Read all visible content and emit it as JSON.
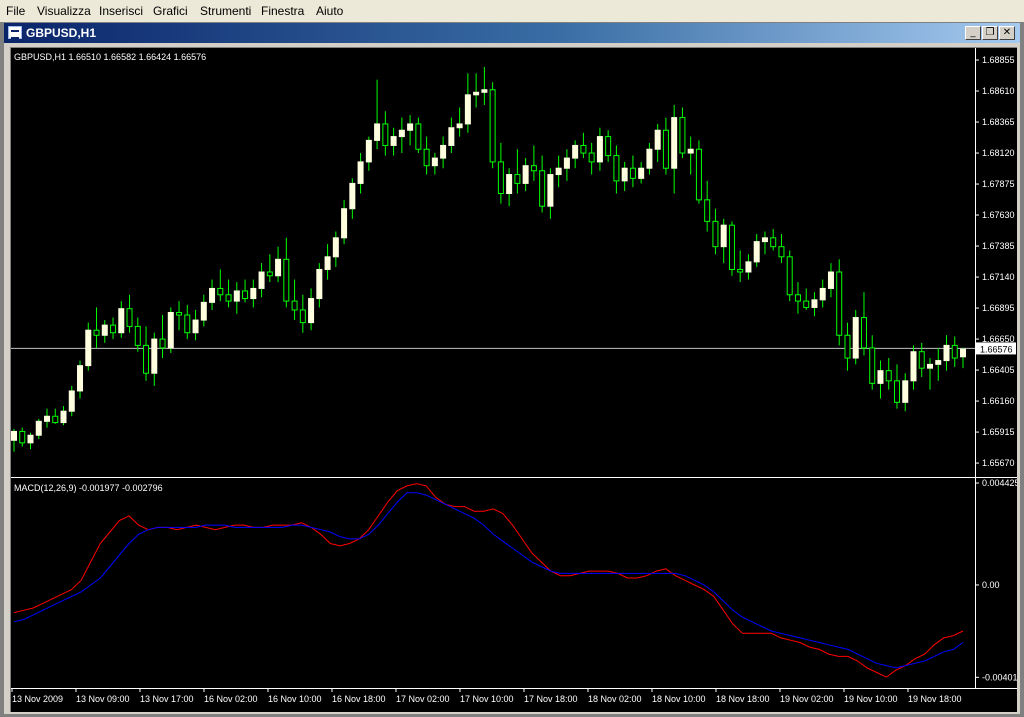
{
  "menu": [
    "File",
    "Visualizza",
    "Inserisci",
    "Grafici",
    "Strumenti",
    "Finestra",
    "Aiuto"
  ],
  "window": {
    "title": "GBPUSD,H1"
  },
  "colors": {
    "bull": "#ffffe0",
    "wick": "#00ff00",
    "price_line": "#c0c0c0",
    "macd": "#ff0000",
    "signal": "#0000ff",
    "axis_text": "#ffffff",
    "background": "#000000"
  },
  "chart_data": [
    {
      "type": "candlestick",
      "title": "GBPUSD,H1  1.66510 1.66582 1.66424 1.66576",
      "ylim": [
        1.6556,
        1.6895
      ],
      "y_ticks": [
        "1.68855",
        "1.68610",
        "1.68365",
        "1.68120",
        "1.67875",
        "1.67630",
        "1.67385",
        "1.67140",
        "1.66895",
        "1.66650",
        "1.66405",
        "1.66160",
        "1.65915",
        "1.65670"
      ],
      "current_price": "1.66576",
      "ohlc": [
        [
          1.6585,
          1.6594,
          1.6576,
          1.6592
        ],
        [
          1.6592,
          1.6595,
          1.658,
          1.6583
        ],
        [
          1.6583,
          1.6591,
          1.6578,
          1.6589
        ],
        [
          1.6589,
          1.6602,
          1.6586,
          1.66
        ],
        [
          1.66,
          1.661,
          1.6595,
          1.6604
        ],
        [
          1.6604,
          1.661,
          1.6598,
          1.6599
        ],
        [
          1.6599,
          1.6612,
          1.6597,
          1.6608
        ],
        [
          1.6608,
          1.6628,
          1.6604,
          1.6624
        ],
        [
          1.6624,
          1.6648,
          1.6618,
          1.6644
        ],
        [
          1.6644,
          1.6678,
          1.664,
          1.6672
        ],
        [
          1.6672,
          1.669,
          1.6658,
          1.6668
        ],
        [
          1.6668,
          1.668,
          1.6662,
          1.6676
        ],
        [
          1.6676,
          1.6682,
          1.6665,
          1.667
        ],
        [
          1.667,
          1.6695,
          1.6666,
          1.6689
        ],
        [
          1.6689,
          1.67,
          1.667,
          1.6675
        ],
        [
          1.6675,
          1.6682,
          1.6655,
          1.666
        ],
        [
          1.666,
          1.6675,
          1.6632,
          1.6638
        ],
        [
          1.6638,
          1.667,
          1.6628,
          1.6665
        ],
        [
          1.6665,
          1.6684,
          1.665,
          1.6658
        ],
        [
          1.6658,
          1.669,
          1.6654,
          1.6686
        ],
        [
          1.6686,
          1.6695,
          1.6672,
          1.6684
        ],
        [
          1.6684,
          1.6692,
          1.6665,
          1.667
        ],
        [
          1.667,
          1.6688,
          1.6664,
          1.668
        ],
        [
          1.668,
          1.67,
          1.6675,
          1.6694
        ],
        [
          1.6694,
          1.6712,
          1.6688,
          1.6705
        ],
        [
          1.6705,
          1.672,
          1.6695,
          1.67
        ],
        [
          1.67,
          1.6712,
          1.669,
          1.6695
        ],
        [
          1.6695,
          1.671,
          1.6685,
          1.6703
        ],
        [
          1.6703,
          1.6712,
          1.6694,
          1.6697
        ],
        [
          1.6697,
          1.6712,
          1.669,
          1.6705
        ],
        [
          1.6705,
          1.6725,
          1.6698,
          1.6718
        ],
        [
          1.6718,
          1.6732,
          1.671,
          1.6715
        ],
        [
          1.6715,
          1.6738,
          1.671,
          1.6728
        ],
        [
          1.6728,
          1.6745,
          1.669,
          1.6695
        ],
        [
          1.6695,
          1.6712,
          1.668,
          1.6688
        ],
        [
          1.6688,
          1.67,
          1.667,
          1.6678
        ],
        [
          1.6678,
          1.6705,
          1.6672,
          1.6697
        ],
        [
          1.6697,
          1.6725,
          1.669,
          1.672
        ],
        [
          1.672,
          1.674,
          1.6712,
          1.673
        ],
        [
          1.673,
          1.675,
          1.6722,
          1.6745
        ],
        [
          1.6745,
          1.6775,
          1.674,
          1.6768
        ],
        [
          1.6768,
          1.6792,
          1.676,
          1.6788
        ],
        [
          1.6788,
          1.6812,
          1.678,
          1.6805
        ],
        [
          1.6805,
          1.6825,
          1.6798,
          1.6822
        ],
        [
          1.6822,
          1.687,
          1.6815,
          1.6835
        ],
        [
          1.6835,
          1.6845,
          1.681,
          1.6818
        ],
        [
          1.6818,
          1.6832,
          1.681,
          1.6825
        ],
        [
          1.6825,
          1.684,
          1.6812,
          1.683
        ],
        [
          1.683,
          1.6842,
          1.6818,
          1.6835
        ],
        [
          1.6835,
          1.684,
          1.6812,
          1.6815
        ],
        [
          1.6815,
          1.6825,
          1.6795,
          1.6802
        ],
        [
          1.6802,
          1.6812,
          1.6795,
          1.6808
        ],
        [
          1.6808,
          1.6825,
          1.68,
          1.6818
        ],
        [
          1.6818,
          1.684,
          1.6812,
          1.6832
        ],
        [
          1.6832,
          1.6848,
          1.6825,
          1.6835
        ],
        [
          1.6835,
          1.6875,
          1.6828,
          1.6858
        ],
        [
          1.6858,
          1.6875,
          1.6848,
          1.686
        ],
        [
          1.686,
          1.688,
          1.685,
          1.6862
        ],
        [
          1.6862,
          1.6868,
          1.68,
          1.6805
        ],
        [
          1.6805,
          1.682,
          1.6772,
          1.678
        ],
        [
          1.678,
          1.68,
          1.677,
          1.6795
        ],
        [
          1.6795,
          1.6815,
          1.678,
          1.6788
        ],
        [
          1.6788,
          1.6808,
          1.6782,
          1.6802
        ],
        [
          1.6802,
          1.6818,
          1.679,
          1.6798
        ],
        [
          1.6798,
          1.681,
          1.6765,
          1.677
        ],
        [
          1.677,
          1.68,
          1.676,
          1.6795
        ],
        [
          1.6795,
          1.681,
          1.6785,
          1.68
        ],
        [
          1.68,
          1.6815,
          1.679,
          1.6808
        ],
        [
          1.6808,
          1.6822,
          1.68,
          1.6818
        ],
        [
          1.6818,
          1.6828,
          1.6808,
          1.6812
        ],
        [
          1.6812,
          1.682,
          1.6795,
          1.6805
        ],
        [
          1.6805,
          1.6832,
          1.6798,
          1.6825
        ],
        [
          1.6825,
          1.683,
          1.6805,
          1.681
        ],
        [
          1.681,
          1.6818,
          1.678,
          1.679
        ],
        [
          1.679,
          1.6805,
          1.6782,
          1.68
        ],
        [
          1.68,
          1.681,
          1.6785,
          1.6792
        ],
        [
          1.6792,
          1.6805,
          1.6788,
          1.68
        ],
        [
          1.68,
          1.682,
          1.6795,
          1.6815
        ],
        [
          1.6815,
          1.6835,
          1.6805,
          1.683
        ],
        [
          1.683,
          1.684,
          1.6795,
          1.68
        ],
        [
          1.68,
          1.685,
          1.678,
          1.684
        ],
        [
          1.684,
          1.6848,
          1.6808,
          1.6812
        ],
        [
          1.6812,
          1.6825,
          1.6795,
          1.6815
        ],
        [
          1.6815,
          1.6822,
          1.6772,
          1.6775
        ],
        [
          1.6775,
          1.679,
          1.675,
          1.6758
        ],
        [
          1.6758,
          1.6768,
          1.6732,
          1.6738
        ],
        [
          1.6738,
          1.676,
          1.6725,
          1.6755
        ],
        [
          1.6755,
          1.6758,
          1.6715,
          1.672
        ],
        [
          1.672,
          1.6735,
          1.671,
          1.6718
        ],
        [
          1.6718,
          1.6732,
          1.6712,
          1.6726
        ],
        [
          1.6726,
          1.6748,
          1.6722,
          1.6742
        ],
        [
          1.6742,
          1.675,
          1.6732,
          1.6745
        ],
        [
          1.6745,
          1.6752,
          1.6735,
          1.6738
        ],
        [
          1.6738,
          1.6748,
          1.6725,
          1.673
        ],
        [
          1.673,
          1.6735,
          1.6695,
          1.67
        ],
        [
          1.67,
          1.671,
          1.6685,
          1.6695
        ],
        [
          1.6695,
          1.6705,
          1.6688,
          1.669
        ],
        [
          1.669,
          1.6702,
          1.6683,
          1.6696
        ],
        [
          1.6696,
          1.6712,
          1.669,
          1.6705
        ],
        [
          1.6705,
          1.6725,
          1.6698,
          1.6718
        ],
        [
          1.6718,
          1.6728,
          1.666,
          1.6668
        ],
        [
          1.6668,
          1.6678,
          1.664,
          1.665
        ],
        [
          1.665,
          1.6688,
          1.6645,
          1.6682
        ],
        [
          1.6682,
          1.6702,
          1.6652,
          1.6658
        ],
        [
          1.6658,
          1.6668,
          1.6625,
          1.663
        ],
        [
          1.663,
          1.6648,
          1.6618,
          1.664
        ],
        [
          1.664,
          1.665,
          1.6625,
          1.6632
        ],
        [
          1.6632,
          1.6645,
          1.661,
          1.6615
        ],
        [
          1.6615,
          1.6638,
          1.6608,
          1.6632
        ],
        [
          1.6632,
          1.666,
          1.6625,
          1.6655
        ],
        [
          1.6655,
          1.6662,
          1.6635,
          1.6642
        ],
        [
          1.6642,
          1.665,
          1.6625,
          1.6645
        ],
        [
          1.6645,
          1.6658,
          1.6632,
          1.6648
        ],
        [
          1.6648,
          1.6668,
          1.664,
          1.666
        ],
        [
          1.666,
          1.6667,
          1.6643,
          1.665
        ],
        [
          1.6651,
          1.6658,
          1.6642,
          1.6657
        ]
      ]
    },
    {
      "type": "line",
      "title": "MACD(12,26,9) -0.001977 -0.002796",
      "ylim": [
        -0.0043,
        0.0046
      ],
      "y_ticks": [
        "0.004425",
        "0.00",
        "-0.00401"
      ],
      "series": [
        {
          "values": [
            -0.0012,
            -0.0011,
            -0.001,
            -0.0008,
            -0.0006,
            -0.0004,
            -0.0002,
            0.0002,
            0.001,
            0.0018,
            0.0023,
            0.0028,
            0.003,
            0.0026,
            0.0024,
            0.0025,
            0.0025,
            0.0024,
            0.0025,
            0.0026,
            0.0025,
            0.0024,
            0.0025,
            0.0026,
            0.0026,
            0.0025,
            0.0025,
            0.0026,
            0.0026,
            0.0026,
            0.0027,
            0.0025,
            0.0022,
            0.0018,
            0.0017,
            0.0018,
            0.002,
            0.0024,
            0.003,
            0.0036,
            0.0041,
            0.0043,
            0.0044,
            0.0043,
            0.0038,
            0.0035,
            0.0034,
            0.0034,
            0.0032,
            0.0032,
            0.0033,
            0.0031,
            0.0026,
            0.002,
            0.0014,
            0.001,
            0.0006,
            0.0004,
            0.0004,
            0.0005,
            0.0006,
            0.0006,
            0.0006,
            0.0005,
            0.0003,
            0.0003,
            0.0004,
            0.0006,
            0.0007,
            0.0004,
            0.0002,
            0.0,
            -0.0002,
            -0.0005,
            -0.0011,
            -0.0017,
            -0.0021,
            -0.0021,
            -0.0021,
            -0.0021,
            -0.0023,
            -0.0024,
            -0.0025,
            -0.0027,
            -0.0028,
            -0.003,
            -0.0031,
            -0.0031,
            -0.0033,
            -0.0036,
            -0.0038,
            -0.004,
            -0.0037,
            -0.0035,
            -0.0032,
            -0.003,
            -0.0026,
            -0.0023,
            -0.0022,
            -0.002
          ]
        },
        {
          "values": [
            -0.0016,
            -0.0015,
            -0.0013,
            -0.0011,
            -0.0009,
            -0.0007,
            -0.0005,
            -0.0003,
            0.0,
            0.0003,
            0.0008,
            0.0013,
            0.0018,
            0.0022,
            0.0024,
            0.0025,
            0.0025,
            0.0025,
            0.0025,
            0.0025,
            0.0026,
            0.0026,
            0.0026,
            0.0025,
            0.0025,
            0.0025,
            0.0025,
            0.0025,
            0.0025,
            0.0026,
            0.0026,
            0.0025,
            0.0024,
            0.0023,
            0.0021,
            0.002,
            0.002,
            0.0022,
            0.0026,
            0.0031,
            0.0036,
            0.004,
            0.004,
            0.0039,
            0.0037,
            0.0035,
            0.0033,
            0.0031,
            0.0029,
            0.0026,
            0.0022,
            0.0019,
            0.0016,
            0.0013,
            0.001,
            0.0008,
            0.0006,
            0.0005,
            0.0005,
            0.0005,
            0.0005,
            0.0005,
            0.0005,
            0.0005,
            0.0005,
            0.0005,
            0.0005,
            0.0005,
            0.0005,
            0.0005,
            0.0004,
            0.0002,
            0.0,
            -0.0003,
            -0.0007,
            -0.0011,
            -0.0014,
            -0.0016,
            -0.0018,
            -0.002,
            -0.0021,
            -0.0022,
            -0.0023,
            -0.0024,
            -0.0025,
            -0.0026,
            -0.0027,
            -0.0028,
            -0.003,
            -0.0032,
            -0.0034,
            -0.0035,
            -0.0036,
            -0.0035,
            -0.0034,
            -0.0033,
            -0.0031,
            -0.0029,
            -0.0028,
            -0.0025
          ]
        }
      ]
    }
  ],
  "time_axis": [
    "13 Nov 2009",
    "13 Nov 09:00",
    "13 Nov 17:00",
    "16 Nov 02:00",
    "16 Nov 10:00",
    "16 Nov 18:00",
    "17 Nov 02:00",
    "17 Nov 10:00",
    "17 Nov 18:00",
    "18 Nov 02:00",
    "18 Nov 10:00",
    "18 Nov 18:00",
    "19 Nov 02:00",
    "19 Nov 10:00",
    "19 Nov 18:00"
  ]
}
